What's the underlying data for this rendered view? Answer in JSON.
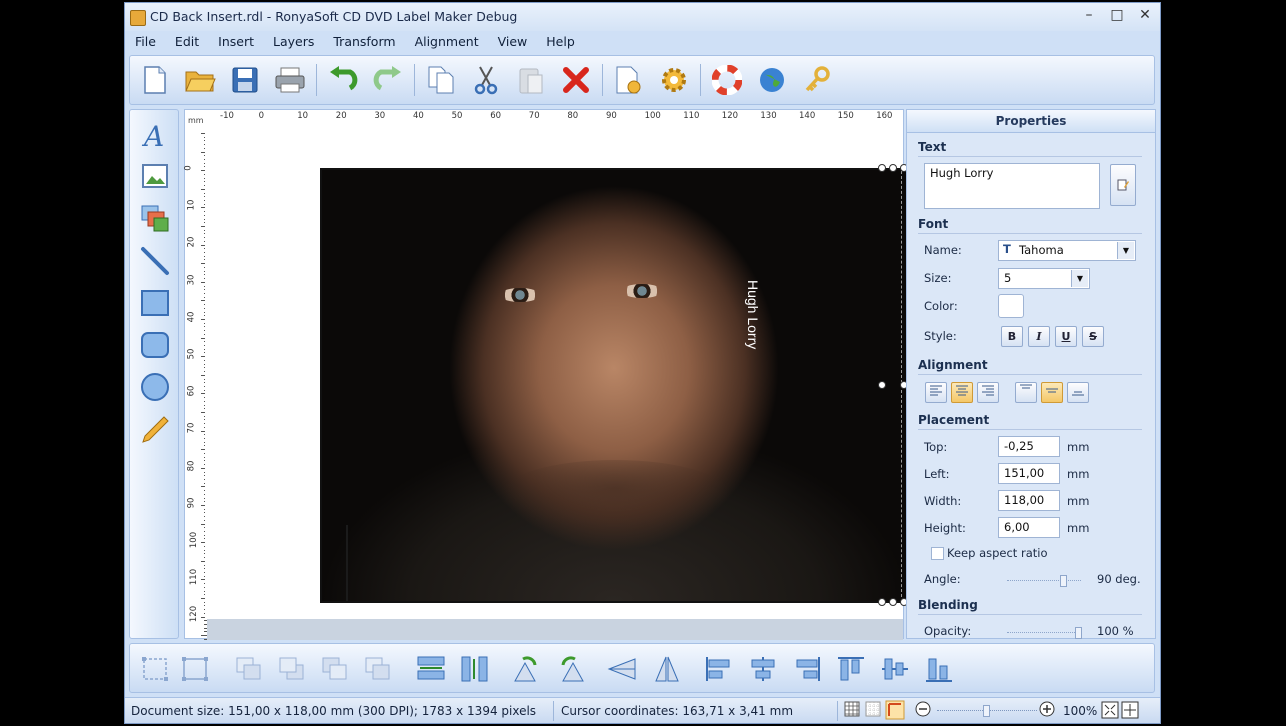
{
  "window": {
    "title": "CD Back Insert.rdl - RonyaSoft CD DVD Label Maker Debug",
    "controls": [
      "–",
      "□",
      "✕"
    ]
  },
  "menu": [
    "File",
    "Edit",
    "Insert",
    "Layers",
    "Transform",
    "Alignment",
    "View",
    "Help"
  ],
  "toolbar": [
    "new-file-icon",
    "open-folder-icon",
    "save-icon",
    "print-icon",
    "undo-icon",
    "redo-icon",
    "copy-icon",
    "cut-icon",
    "paste-icon",
    "delete-icon",
    "page-settings-icon",
    "options-gear-icon",
    "help-lifebuoy-icon",
    "web-globe-icon",
    "register-key-icon"
  ],
  "left_tools": [
    "text-tool-icon",
    "image-tool-icon",
    "image-set-tool-icon",
    "line-tool-icon",
    "rectangle-tool-icon",
    "rounded-rectangle-tool-icon",
    "ellipse-tool-icon",
    "pencil-tool-icon"
  ],
  "ruler": {
    "unit": "mm",
    "h_labels": [
      "-10",
      "0",
      "10",
      "20",
      "30",
      "40",
      "50",
      "60",
      "70",
      "80",
      "90",
      "100",
      "110",
      "120",
      "130",
      "140",
      "150",
      "160"
    ],
    "v_labels": [
      "0",
      "10",
      "20",
      "30",
      "40",
      "50",
      "60",
      "70",
      "80",
      "90",
      "100",
      "110",
      "120"
    ]
  },
  "canvas": {
    "text_element": "Hugh Lorry"
  },
  "properties": {
    "header": "Properties",
    "text_section": "Text",
    "text_value": "Hugh Lorry",
    "font_section": "Font",
    "name_label": "Name:",
    "font_name": "Tahoma",
    "size_label": "Size:",
    "font_size": "5",
    "color_label": "Color:",
    "style_label": "Style:",
    "style_buttons": [
      "B",
      "I",
      "U",
      "S"
    ],
    "alignment_section": "Alignment",
    "placement_section": "Placement",
    "top_label": "Top:",
    "top_value": "-0,25",
    "left_label": "Left:",
    "left_value": "151,00",
    "width_label": "Width:",
    "width_value": "118,00",
    "height_label": "Height:",
    "height_value": "6,00",
    "unit": "mm",
    "keep_aspect_label": "Keep aspect ratio",
    "keep_aspect_checked": false,
    "angle_label": "Angle:",
    "angle_value": "90 deg.",
    "angle_fraction": 0.75,
    "blending_section": "Blending",
    "opacity_label": "Opacity:",
    "opacity_value": "100 %",
    "opacity_fraction": 1.0
  },
  "bottom_toolbar": [
    "group-icon",
    "ungroup-icon",
    "bring-to-front-icon",
    "send-to-back-icon",
    "bring-forward-icon",
    "send-backward-icon",
    "same-width-icon",
    "same-height-icon",
    "rotate-left-icon",
    "rotate-right-icon",
    "flip-horizontal-icon",
    "flip-vertical-icon",
    "align-left-icon",
    "align-center-icon",
    "align-right-icon",
    "align-top-icon",
    "align-middle-icon",
    "align-bottom-icon"
  ],
  "status": {
    "document": "Document size: 151,00 x 118,00 mm (300 DPI); 1783 x 1394 pixels",
    "cursor": "Cursor coordinates: 163,71 x 3,41 mm",
    "zoom": "100%"
  }
}
